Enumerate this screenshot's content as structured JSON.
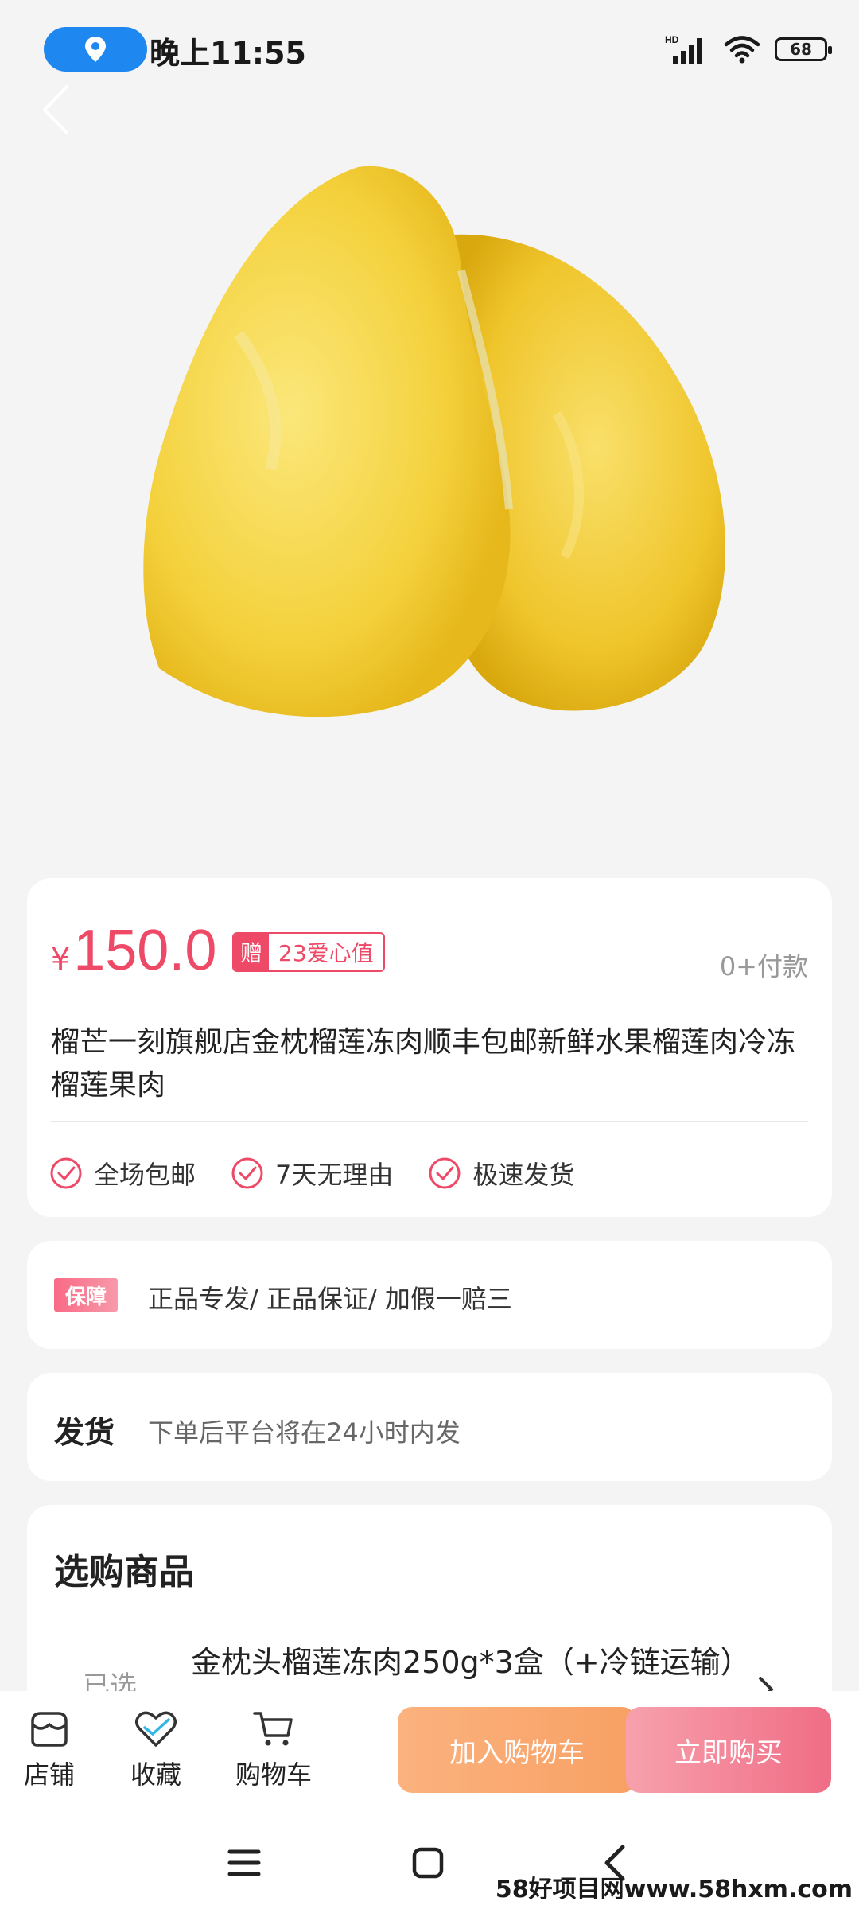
{
  "status": {
    "time": "晚上11:55",
    "battery": "68",
    "network": "HD"
  },
  "product": {
    "price_symbol": "¥",
    "price": "150.0",
    "gift_tag": "赠",
    "gift_text": "23爱心值",
    "paid_count": "0+付款",
    "title": "榴芒一刻旗舰店金枕榴莲冻肉顺丰包邮新鲜水果榴莲肉冷冻榴莲果肉",
    "features": [
      "全场包邮",
      "7天无理由",
      "极速发货"
    ]
  },
  "guarantee": {
    "badge": "保障",
    "text": "正品专发/  正品保证/ 加假一赔三"
  },
  "shipping": {
    "label": "发货",
    "text": "下单后平台将在24小时内发"
  },
  "select": {
    "title": "选购商品",
    "selected_label": "已选",
    "selected_value": "金枕头榴莲冻肉250g*3盒（+冷链运输）"
  },
  "bottom_bar": {
    "store": "店铺",
    "favorite": "收藏",
    "cart": "购物车",
    "add_to_cart": "加入购物车",
    "buy_now": "立即购买"
  },
  "watermark": "58好项目网www.58hxm.com",
  "colors": {
    "accent": "#ee4966",
    "location_pill": "#1e88f0",
    "cart_button": "#f8a064",
    "buy_button": "#f06d86"
  }
}
